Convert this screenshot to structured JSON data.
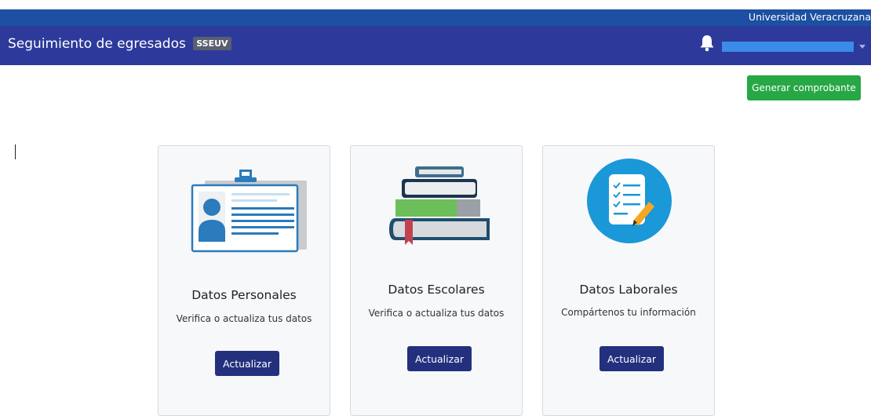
{
  "header": {
    "institution": "Universidad Veracruzana",
    "app_title": "Seguimiento de egresados",
    "app_badge": "SSEUV",
    "notification_icon": "bell-icon",
    "user_menu_icon": "chevron-down-icon"
  },
  "actions": {
    "generate_label": "Generar comprobante"
  },
  "cards": [
    {
      "title": "Datos Personales",
      "description": "Verifica o actualiza tus datos",
      "button_label": "Actualizar",
      "icon": "id-card-icon"
    },
    {
      "title": "Datos Escolares",
      "description": "Verifica o actualiza tus datos",
      "button_label": "Actualizar",
      "icon": "books-icon"
    },
    {
      "title": "Datos Laborales",
      "description": "Compártenos tu información",
      "button_label": "Actualizar",
      "icon": "checklist-icon"
    }
  ],
  "colors": {
    "top_strip": "#1d4fa2",
    "navbar": "#2d3a9c",
    "primary_button": "#23307e",
    "success_button": "#28a745"
  }
}
